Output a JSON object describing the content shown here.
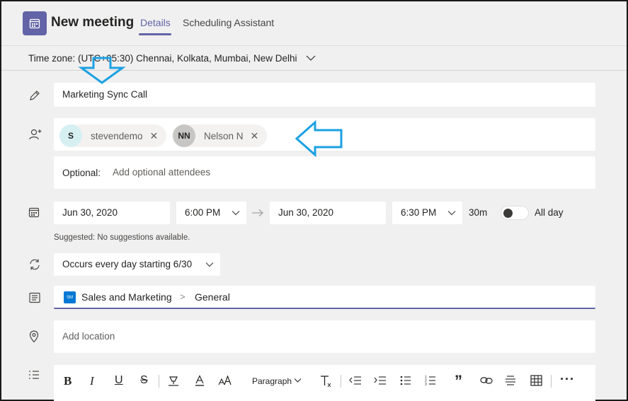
{
  "header": {
    "title": "New meeting",
    "tabs": [
      {
        "label": "Details",
        "active": true
      },
      {
        "label": "Scheduling Assistant",
        "active": false
      }
    ]
  },
  "timezone": {
    "label": "Time zone: (UTC+05:30) Chennai, Kolkata, Mumbai, New Delhi"
  },
  "form": {
    "title_value": "Marketing Sync Call",
    "attendees": [
      {
        "initials": "S",
        "name": "stevendemo",
        "avatar_color": "#d6f0f2"
      },
      {
        "initials": "NN",
        "name": "Nelson N",
        "avatar_color": "#c8c6c4"
      }
    ],
    "optional_label": "Optional:",
    "optional_placeholder": "Add optional attendees",
    "start_date": "Jun 30, 2020",
    "start_time": "6:00 PM",
    "end_date": "Jun 30, 2020",
    "end_time": "6:30 PM",
    "duration": "30m",
    "all_day_label": "All day",
    "all_day_on": false,
    "suggested": "Suggested: No suggestions available.",
    "recurrence": "Occurs every day starting 6/30",
    "channel": {
      "team_badge": "SM",
      "team": "Sales and Marketing",
      "separator": ">",
      "channel": "General"
    },
    "location_placeholder": "Add location"
  },
  "toolbar": {
    "paragraph_label": "Paragraph"
  },
  "colors": {
    "accent": "#6264a7",
    "annotation_arrow": "#1ba1e2",
    "team_badge": "#0078d4"
  }
}
